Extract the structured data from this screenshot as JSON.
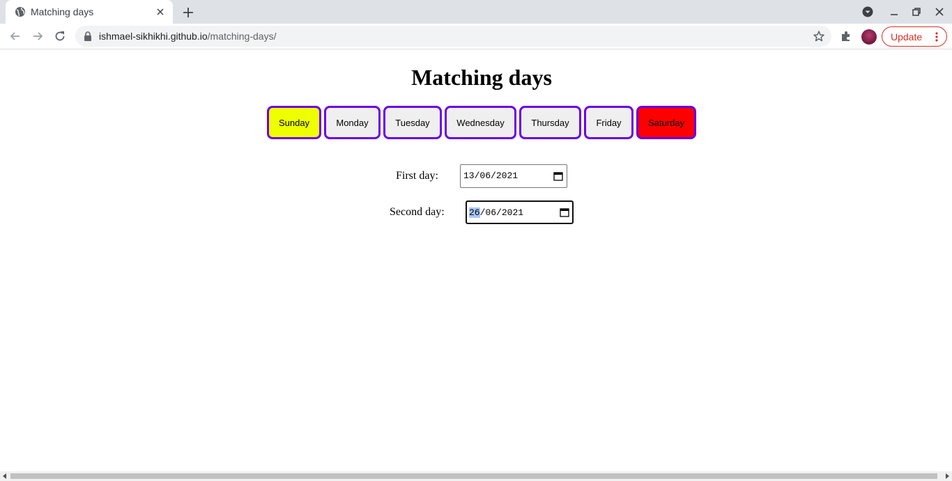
{
  "browser": {
    "tab_title": "Matching days",
    "url_host": "ishmael-sikhikhi.github.io",
    "url_path": "/matching-days/",
    "update_label": "Update"
  },
  "page": {
    "title": "Matching days",
    "days": [
      {
        "label": "Sunday",
        "color": "#eeff00"
      },
      {
        "label": "Monday",
        "color": "#efefef"
      },
      {
        "label": "Tuesday",
        "color": "#efefef"
      },
      {
        "label": "Wednesday",
        "color": "#efefef"
      },
      {
        "label": "Thursday",
        "color": "#efefef"
      },
      {
        "label": "Friday",
        "color": "#efefef"
      },
      {
        "label": "Saturday",
        "color": "#ff0000"
      }
    ],
    "border_color": "#6a00e8",
    "first_day": {
      "label": "First day:",
      "day": "13",
      "month": "06",
      "year": "2021"
    },
    "second_day": {
      "label": "Second day:",
      "day": "26",
      "month": "06",
      "year": "2021"
    }
  }
}
